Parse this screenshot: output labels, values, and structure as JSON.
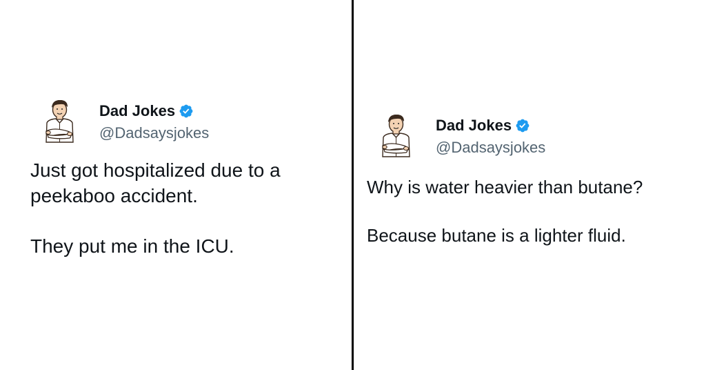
{
  "colors": {
    "text": "#0f1419",
    "handle": "#536471",
    "verified_badge": "#1d9bf0",
    "divider": "#000000",
    "background": "#ffffff"
  },
  "tweets": [
    {
      "author": {
        "display_name": "Dad Jokes",
        "handle": "@Dadsaysjokes",
        "avatar_icon": "cartoon-man-avatar-icon",
        "verified_icon": "verified-badge-icon"
      },
      "paragraphs": [
        {
          "lines": [
            "Just got hospitalized due to a",
            "peekaboo accident."
          ]
        },
        {
          "lines": [
            "They put me in the ICU."
          ]
        }
      ]
    },
    {
      "author": {
        "display_name": "Dad Jokes",
        "handle": "@Dadsaysjokes",
        "avatar_icon": "cartoon-man-avatar-icon",
        "verified_icon": "verified-badge-icon"
      },
      "paragraphs": [
        {
          "lines": [
            "Why is water heavier than butane?"
          ]
        },
        {
          "lines": [
            "Because butane is a lighter fluid."
          ]
        }
      ]
    }
  ]
}
